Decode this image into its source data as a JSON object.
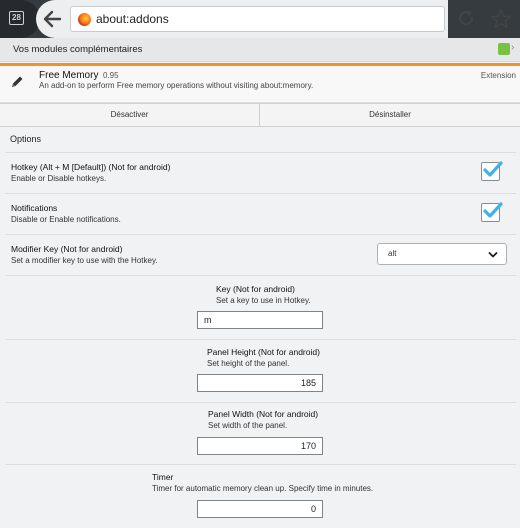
{
  "browser": {
    "tab_count": "28",
    "url": "about:addons"
  },
  "header": {
    "title": "Vos modules complémentaires"
  },
  "addon": {
    "name": "Free Memory",
    "version": "0.95",
    "description": "An add-on to perform Free memory operations without visiting about:memory.",
    "type": "Extension"
  },
  "actions": {
    "disable_label": "Désactiver",
    "uninstall_label": "Désinstaller"
  },
  "options": {
    "title": "Options",
    "hotkey": {
      "label": "Hotkey (Alt + M [Default]) (Not for android)",
      "description": "Enable or Disable hotkeys.",
      "checked": true
    },
    "notifications": {
      "label": "Notifications",
      "description": "Disable or Enable notifications.",
      "checked": true
    },
    "modifier_key": {
      "label": "Modifier Key (Not for android)",
      "description": "Set a modifier key to use with the Hotkey.",
      "value": "alt"
    },
    "key": {
      "label": "Key (Not for android)",
      "description": "Set a key to use in Hotkey.",
      "value": "m"
    },
    "panel_height": {
      "label": "Panel Height (Not for android)",
      "description": "Set height of the panel.",
      "value": "185"
    },
    "panel_width": {
      "label": "Panel Width (Not for android)",
      "description": "Set width of the panel.",
      "value": "170"
    },
    "timer": {
      "label": "Timer",
      "description": "Timer for automatic memory clean up. Specify time in minutes.",
      "value": "0"
    }
  },
  "colors": {
    "accent_orange": "#f39224",
    "checkbox_check": "#3fb3e6",
    "toolbar_dark": "#363b40"
  }
}
